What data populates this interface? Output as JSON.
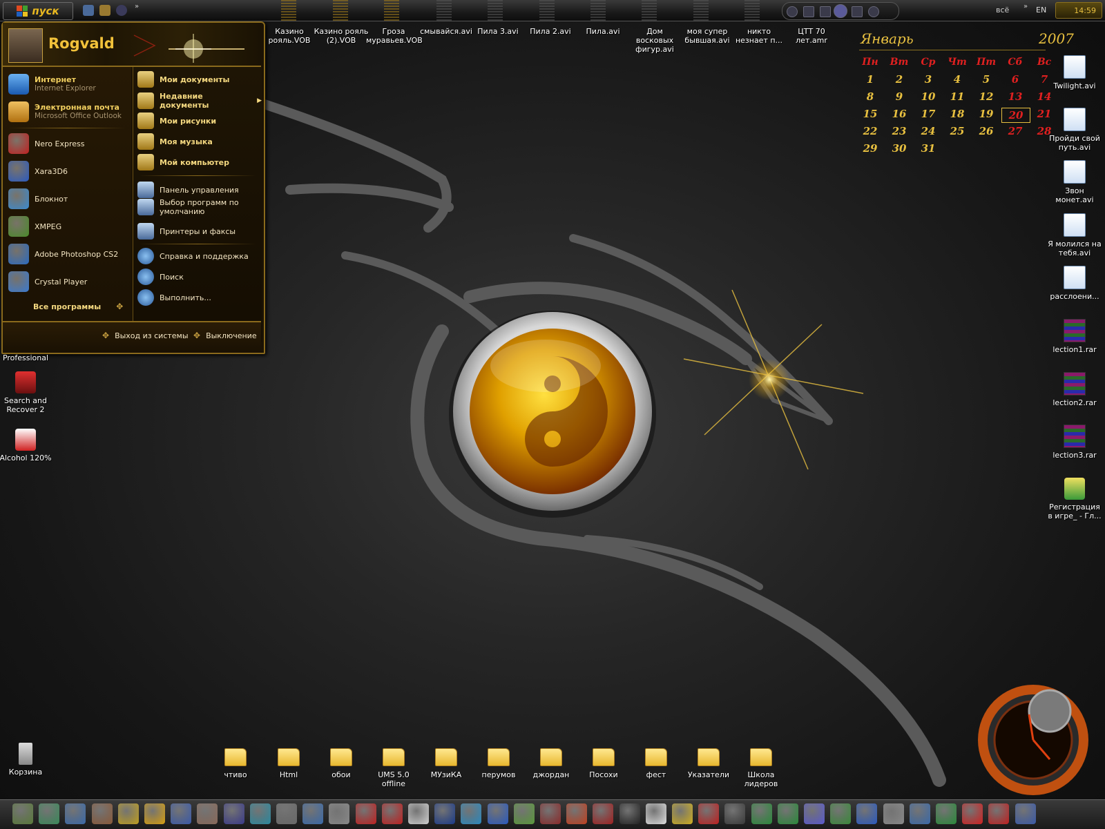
{
  "taskbar_top": {
    "start_label": "пуск",
    "tray_text": "всё",
    "language": "EN",
    "clock": "14:59"
  },
  "top_files": [
    "Казино рояль.VOB",
    "Казино рояль (2).VOB",
    "Гроза муравьев.VOB",
    "смывайся.avi",
    "Пила 3.avi",
    "Пила 2.avi",
    "Пила.avi",
    "Дом восковых фигур.avi",
    "моя супер бывшая.avi",
    "никто незнает п...",
    "ЦТТ 70 лет.amr"
  ],
  "start_menu": {
    "user": "Rogvald",
    "pinned": [
      {
        "title": "Интернет",
        "sub": "Internet Explorer",
        "icon": "internet-explorer-icon"
      },
      {
        "title": "Электронная почта",
        "sub": "Microsoft Office Outlook",
        "icon": "outlook-icon"
      }
    ],
    "recent": [
      {
        "label": "Nero Express",
        "icon": "nero-icon"
      },
      {
        "label": "Xara3D6",
        "icon": "xara3d-icon"
      },
      {
        "label": "Блокнот",
        "icon": "notepad-icon"
      },
      {
        "label": "XMPEG",
        "icon": "xmpeg-icon"
      },
      {
        "label": "Adobe Photoshop CS2",
        "icon": "photoshop-icon"
      },
      {
        "label": "Crystal Player",
        "icon": "crystal-player-icon"
      }
    ],
    "all_programs": "Все программы",
    "right_main": [
      {
        "label": "Мои документы",
        "icon": "my-documents-icon"
      },
      {
        "label": "Недавние документы",
        "icon": "recent-documents-icon"
      },
      {
        "label": "Мои рисунки",
        "icon": "my-pictures-icon"
      },
      {
        "label": "Моя музыка",
        "icon": "my-music-icon"
      },
      {
        "label": "Мой компьютер",
        "icon": "my-computer-icon"
      }
    ],
    "right_sys": [
      {
        "label": "Панель управления",
        "icon": "control-panel-icon"
      },
      {
        "label": "Выбор программ по умолчанию",
        "icon": "default-programs-icon"
      },
      {
        "label": "Принтеры и факсы",
        "icon": "printers-icon"
      }
    ],
    "right_help": [
      {
        "label": "Справка и поддержка",
        "icon": "help-icon"
      },
      {
        "label": "Поиск",
        "icon": "search-icon"
      },
      {
        "label": "Выполнить...",
        "icon": "run-icon"
      }
    ],
    "logoff": "Выход из системы",
    "shutdown": "Выключение"
  },
  "calendar": {
    "month": "Январь",
    "year": "2007",
    "weekdays": [
      "Пн",
      "Вт",
      "Ср",
      "Чт",
      "Пт",
      "Сб",
      "Вс"
    ],
    "days": [
      "1",
      "2",
      "3",
      "4",
      "5",
      "6",
      "7",
      "8",
      "9",
      "10",
      "11",
      "12",
      "13",
      "14",
      "15",
      "16",
      "17",
      "18",
      "19",
      "20",
      "21",
      "22",
      "23",
      "24",
      "25",
      "26",
      "27",
      "28",
      "29",
      "30",
      "31"
    ],
    "today": "20"
  },
  "left_icons": [
    {
      "label": "Professional"
    },
    {
      "label": "Search and Recover 2"
    },
    {
      "label": "Alcohol 120%"
    },
    {
      "label": "Корзина"
    }
  ],
  "right_icons": [
    {
      "label": "Twilight.avi",
      "kind": "file"
    },
    {
      "label": "Пройди свой путь.avi",
      "kind": "file"
    },
    {
      "label": "Звон монет.avi",
      "kind": "file"
    },
    {
      "label": "Я молился на тебя.avi",
      "kind": "file"
    },
    {
      "label": "расслоени...",
      "kind": "doc"
    },
    {
      "label": "lection1.rar",
      "kind": "rar"
    },
    {
      "label": "lection2.rar",
      "kind": "rar"
    },
    {
      "label": "lection3.rar",
      "kind": "rar"
    },
    {
      "label": "Регистрация в игре_ - Гл...",
      "kind": "web"
    }
  ],
  "bottom_folders": [
    "чтиво",
    "Html",
    "обои",
    "UMS 5.0 offline",
    "МУзиКА",
    "перумов",
    "джордан",
    "Посохи",
    "фест",
    "Указатели",
    "Школа лидеров"
  ],
  "taskbar_bottom": {
    "icon_count_label": "34",
    "colors": [
      "#5a7a3a",
      "#3a8a5a",
      "#3a6aaa",
      "#8a5a3a",
      "#c0a020",
      "#d8a010",
      "#3a5aaa",
      "#8a6a5a",
      "#3a3a8a",
      "#2a8aa0",
      "#6a6a6a",
      "#3a6aaa",
      "#8a8a8a",
      "#c02020",
      "#c02020",
      "#d0d0d0",
      "#1a3a8a",
      "#2a8ac0",
      "#2a5ac0",
      "#5a9a3a",
      "#8a2a2a",
      "#c04020",
      "#a02020",
      "#222222",
      "#e0e0e0",
      "#d0b020",
      "#c02020",
      "#3a3a3a",
      "#2a8a3a",
      "#2a8a3a",
      "#5a5ad0",
      "#3a8a3a",
      "#2a5ac0",
      "#8a8a8a",
      "#3a6aaa",
      "#2a8a3a",
      "#d02020",
      "#c02020",
      "#3a5aaa"
    ]
  },
  "accent_gold": "#e8c040"
}
